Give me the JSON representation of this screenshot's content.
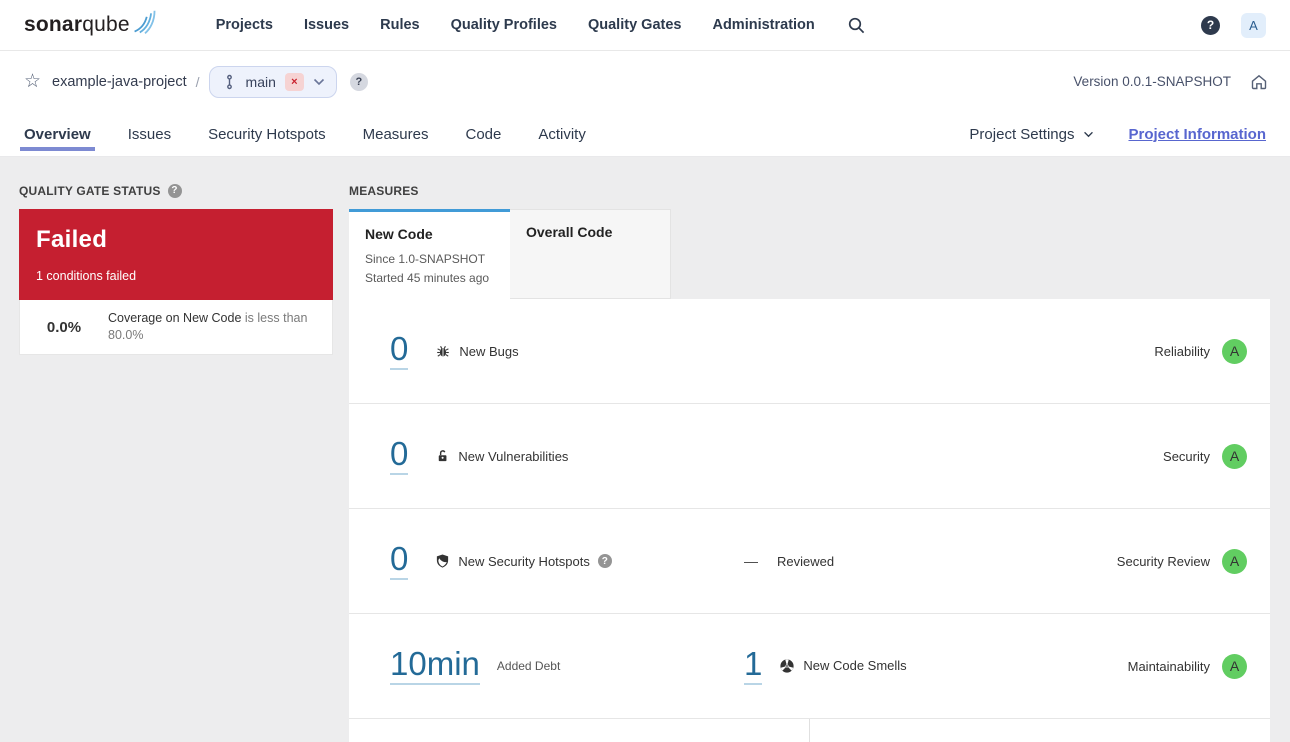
{
  "topnav": {
    "logo_bold": "sonar",
    "logo_light": "qube",
    "items": [
      "Projects",
      "Issues",
      "Rules",
      "Quality Profiles",
      "Quality Gates",
      "Administration"
    ],
    "help_label": "?",
    "avatar_label": "A"
  },
  "breadcrumb": {
    "project": "example-java-project",
    "separator": "/",
    "branch_name": "main",
    "branch_close": "×",
    "help_label": "?",
    "version": "Version 0.0.1-SNAPSHOT"
  },
  "tabs": {
    "items": [
      "Overview",
      "Issues",
      "Security Hotspots",
      "Measures",
      "Code",
      "Activity"
    ],
    "active": "Overview",
    "project_settings": "Project Settings",
    "project_information": "Project Information"
  },
  "quality_gate": {
    "title": "QUALITY GATE STATUS",
    "help_label": "?",
    "status": "Failed",
    "conditions_summary": "1 conditions failed",
    "condition_value": "0.0%",
    "condition_metric": "Coverage on New Code",
    "condition_threshold": "is less than 80.0%"
  },
  "measures": {
    "title": "MEASURES",
    "tabs": {
      "new_code": {
        "label": "New Code",
        "since": "Since 1.0-SNAPSHOT",
        "started": "Started 45 minutes ago"
      },
      "overall_code": {
        "label": "Overall Code"
      }
    },
    "rows": [
      {
        "value": "0",
        "icon": "bug-icon",
        "label": "New Bugs",
        "category": "Reliability",
        "rating": "A"
      },
      {
        "value": "0",
        "icon": "lock-icon",
        "label": "New Vulnerabilities",
        "category": "Security",
        "rating": "A"
      },
      {
        "value": "0",
        "icon": "shield-icon",
        "label": "New Security Hotspots",
        "help_label": "?",
        "reviewed_dash": "—",
        "reviewed_label": "Reviewed",
        "category": "Security Review",
        "rating": "A"
      },
      {
        "value": "10min",
        "label": "Added Debt",
        "second_value": "1",
        "second_icon": "code-smell-icon",
        "second_label": "New Code Smells",
        "category": "Maintainability",
        "rating": "A"
      }
    ]
  },
  "colors": {
    "failed_red": "#c51f30",
    "rating_a_green": "#61cd61",
    "metric_blue": "#236a97",
    "active_tab_underline": "#7d8ad2",
    "project_info_link": "#5866cf",
    "new_code_tab_bar": "#419bd7"
  }
}
